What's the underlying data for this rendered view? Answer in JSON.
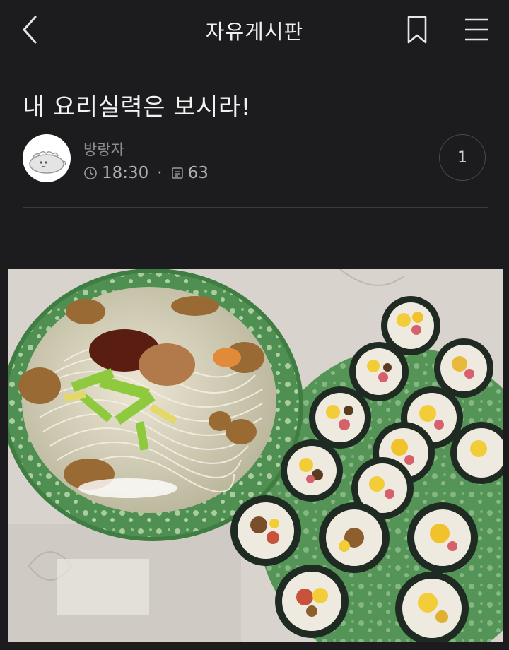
{
  "header": {
    "board_title": "자유게시판",
    "back_icon": "chevron-left-icon",
    "bookmark_icon": "bookmark-icon",
    "menu_icon": "hamburger-menu-icon"
  },
  "post": {
    "title": "내 요리실력은 보시라!",
    "author": "방랑자",
    "time": "18:30",
    "separator": "·",
    "views": "63",
    "comment_count": "1",
    "photo": {
      "alt": "A bowl of noodle soup with clams, sauce and zucchini next to a plate of sliced kimbap"
    }
  },
  "colors": {
    "background": "#1c1c1e",
    "text_primary": "#f2f2f2",
    "text_secondary": "#8d8d8f",
    "divider": "#3a3a3c"
  }
}
